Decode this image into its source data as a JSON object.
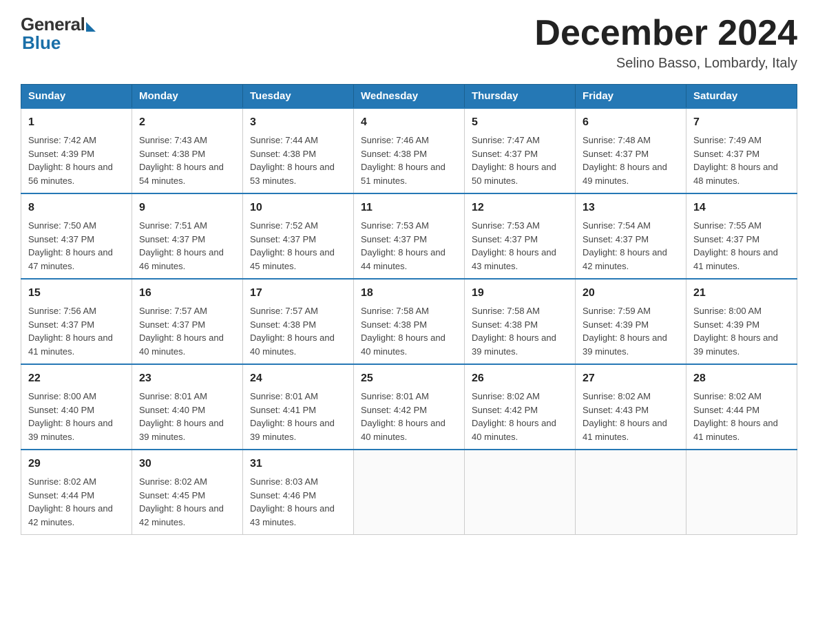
{
  "logo": {
    "general": "General",
    "blue": "Blue"
  },
  "title": "December 2024",
  "location": "Selino Basso, Lombardy, Italy",
  "days_of_week": [
    "Sunday",
    "Monday",
    "Tuesday",
    "Wednesday",
    "Thursday",
    "Friday",
    "Saturday"
  ],
  "weeks": [
    [
      {
        "num": "1",
        "sunrise": "7:42 AM",
        "sunset": "4:39 PM",
        "daylight": "8 hours and 56 minutes."
      },
      {
        "num": "2",
        "sunrise": "7:43 AM",
        "sunset": "4:38 PM",
        "daylight": "8 hours and 54 minutes."
      },
      {
        "num": "3",
        "sunrise": "7:44 AM",
        "sunset": "4:38 PM",
        "daylight": "8 hours and 53 minutes."
      },
      {
        "num": "4",
        "sunrise": "7:46 AM",
        "sunset": "4:38 PM",
        "daylight": "8 hours and 51 minutes."
      },
      {
        "num": "5",
        "sunrise": "7:47 AM",
        "sunset": "4:37 PM",
        "daylight": "8 hours and 50 minutes."
      },
      {
        "num": "6",
        "sunrise": "7:48 AM",
        "sunset": "4:37 PM",
        "daylight": "8 hours and 49 minutes."
      },
      {
        "num": "7",
        "sunrise": "7:49 AM",
        "sunset": "4:37 PM",
        "daylight": "8 hours and 48 minutes."
      }
    ],
    [
      {
        "num": "8",
        "sunrise": "7:50 AM",
        "sunset": "4:37 PM",
        "daylight": "8 hours and 47 minutes."
      },
      {
        "num": "9",
        "sunrise": "7:51 AM",
        "sunset": "4:37 PM",
        "daylight": "8 hours and 46 minutes."
      },
      {
        "num": "10",
        "sunrise": "7:52 AM",
        "sunset": "4:37 PM",
        "daylight": "8 hours and 45 minutes."
      },
      {
        "num": "11",
        "sunrise": "7:53 AM",
        "sunset": "4:37 PM",
        "daylight": "8 hours and 44 minutes."
      },
      {
        "num": "12",
        "sunrise": "7:53 AM",
        "sunset": "4:37 PM",
        "daylight": "8 hours and 43 minutes."
      },
      {
        "num": "13",
        "sunrise": "7:54 AM",
        "sunset": "4:37 PM",
        "daylight": "8 hours and 42 minutes."
      },
      {
        "num": "14",
        "sunrise": "7:55 AM",
        "sunset": "4:37 PM",
        "daylight": "8 hours and 41 minutes."
      }
    ],
    [
      {
        "num": "15",
        "sunrise": "7:56 AM",
        "sunset": "4:37 PM",
        "daylight": "8 hours and 41 minutes."
      },
      {
        "num": "16",
        "sunrise": "7:57 AM",
        "sunset": "4:37 PM",
        "daylight": "8 hours and 40 minutes."
      },
      {
        "num": "17",
        "sunrise": "7:57 AM",
        "sunset": "4:38 PM",
        "daylight": "8 hours and 40 minutes."
      },
      {
        "num": "18",
        "sunrise": "7:58 AM",
        "sunset": "4:38 PM",
        "daylight": "8 hours and 40 minutes."
      },
      {
        "num": "19",
        "sunrise": "7:58 AM",
        "sunset": "4:38 PM",
        "daylight": "8 hours and 39 minutes."
      },
      {
        "num": "20",
        "sunrise": "7:59 AM",
        "sunset": "4:39 PM",
        "daylight": "8 hours and 39 minutes."
      },
      {
        "num": "21",
        "sunrise": "8:00 AM",
        "sunset": "4:39 PM",
        "daylight": "8 hours and 39 minutes."
      }
    ],
    [
      {
        "num": "22",
        "sunrise": "8:00 AM",
        "sunset": "4:40 PM",
        "daylight": "8 hours and 39 minutes."
      },
      {
        "num": "23",
        "sunrise": "8:01 AM",
        "sunset": "4:40 PM",
        "daylight": "8 hours and 39 minutes."
      },
      {
        "num": "24",
        "sunrise": "8:01 AM",
        "sunset": "4:41 PM",
        "daylight": "8 hours and 39 minutes."
      },
      {
        "num": "25",
        "sunrise": "8:01 AM",
        "sunset": "4:42 PM",
        "daylight": "8 hours and 40 minutes."
      },
      {
        "num": "26",
        "sunrise": "8:02 AM",
        "sunset": "4:42 PM",
        "daylight": "8 hours and 40 minutes."
      },
      {
        "num": "27",
        "sunrise": "8:02 AM",
        "sunset": "4:43 PM",
        "daylight": "8 hours and 41 minutes."
      },
      {
        "num": "28",
        "sunrise": "8:02 AM",
        "sunset": "4:44 PM",
        "daylight": "8 hours and 41 minutes."
      }
    ],
    [
      {
        "num": "29",
        "sunrise": "8:02 AM",
        "sunset": "4:44 PM",
        "daylight": "8 hours and 42 minutes."
      },
      {
        "num": "30",
        "sunrise": "8:02 AM",
        "sunset": "4:45 PM",
        "daylight": "8 hours and 42 minutes."
      },
      {
        "num": "31",
        "sunrise": "8:03 AM",
        "sunset": "4:46 PM",
        "daylight": "8 hours and 43 minutes."
      },
      null,
      null,
      null,
      null
    ]
  ]
}
